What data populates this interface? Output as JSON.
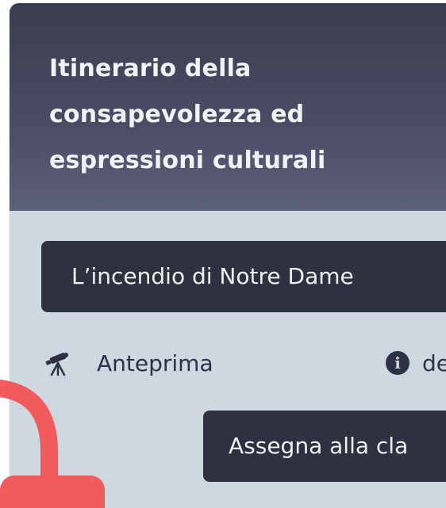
{
  "card": {
    "title": "Itinerario della\nconsapevolezza ed\nespressioni culturali"
  },
  "lesson": {
    "label": "L’incendio di Notre Dame"
  },
  "preview": {
    "label": "Anteprima",
    "icon": "telescope-icon"
  },
  "info": {
    "icon": "info-icon",
    "glyph": "i",
    "label": "de"
  },
  "assign": {
    "label": "Assegna alla cla"
  },
  "colors": {
    "header": "#3a3c50",
    "card_body": "#cdd8e1",
    "button": "#2f3140",
    "annotation": "#f35a5e"
  }
}
